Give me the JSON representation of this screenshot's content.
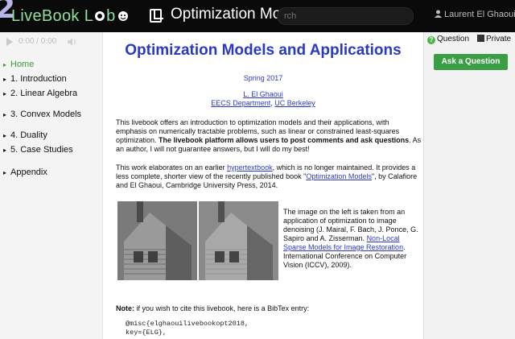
{
  "topbar": {
    "brand": "LiveBook",
    "brand_lab": "L",
    "brand_suffix": "b",
    "page_title": "Optimization Models and",
    "search_placeholder": "rch",
    "user_name": "Laurent El Ghaoui"
  },
  "player": {
    "time": "0:00 / 0:00"
  },
  "sidebar": {
    "items": [
      {
        "label": "Home"
      },
      {
        "label": "1. Introduction"
      },
      {
        "label": "2. Linear Algebra"
      },
      {
        "label": "3. Convex Models"
      },
      {
        "label": "4. Duality"
      },
      {
        "label": "5. Case Studies"
      },
      {
        "label": "Appendix"
      }
    ]
  },
  "main": {
    "title": "Optimization Models and Applications",
    "subtitle": "Spring 2017",
    "author": "L. El Ghaoui",
    "affil_dept": "EECS Department",
    "affil_sep": ", ",
    "affil_univ": "UC Berkeley",
    "p1_a": "This livebook offers an introduction to optimization models and their applications, with emphasis on numerically tractable problems, such as linear or constrained least-squares optimization. ",
    "p1_b": "The livebook platform allows users to post comments and ask questions",
    "p1_c": ". As an author, I will not guarantee answers, but I will do my best!",
    "p2_a": "This work elaborates on an earlier ",
    "p2_link1": "hypertextbook",
    "p2_b": ", which is no longer maintained. It provides a less complete, shorter view of the recently published book \"",
    "p2_link2": "Optimization Models",
    "p2_c": "\", by Calafiore and El Ghaoui, Cambridge University Press, 2014.",
    "caption_a": "The image on the left is taken from an application of optimization to image denoising (J. Mairal, F. Bach, J. Ponce, G. Sapiro and A. Zisserman. ",
    "caption_link": "Non-Local Sparse Models for Image Restoration",
    "caption_b": ". International Conference on Computer Vision (ICCV), 2009).",
    "note_label": "Note:",
    "note_text": " if you wish to cite this livebook, here is a BibTex entry:",
    "code_line1": "@misc{elghaouilivebookopt2018,",
    "code_line2": "key={ELG},"
  },
  "rpanel": {
    "tab_questions": "Question",
    "tab_private": "Private",
    "ask_button": "Ask a Question"
  },
  "colors": {
    "brand_green": "#8ee09e",
    "link_blue": "#2a39c4",
    "button_green": "#3a9e45"
  }
}
